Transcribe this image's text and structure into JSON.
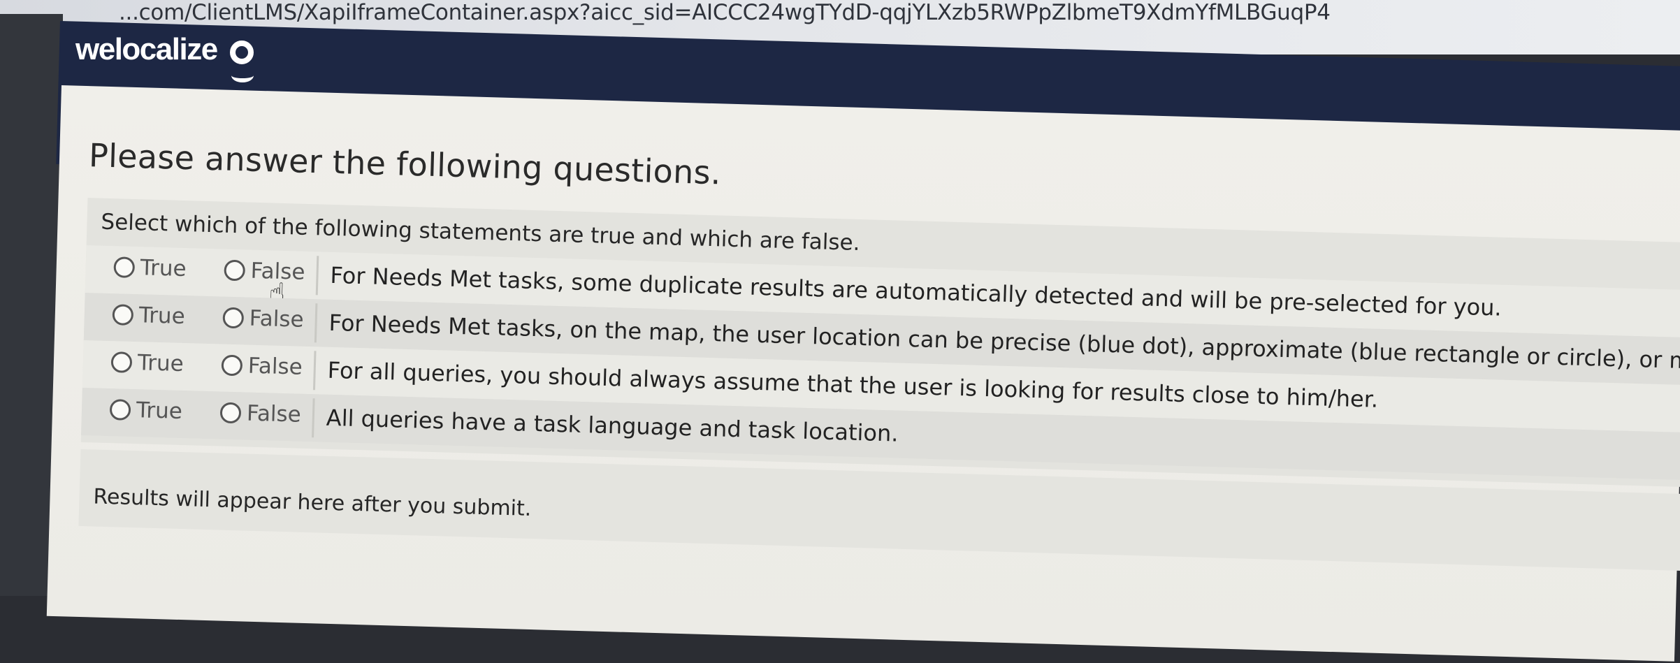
{
  "browser": {
    "url": "...com/ClientLMS/XapiIframeContainer.aspx?aicc_sid=AICCC24wgTYdD-qqjYLXzb5RWPpZlbmeT9XdmYfMLBGuqP4"
  },
  "header": {
    "logo_text": "welocalize"
  },
  "main": {
    "title": "Please answer the following questions.",
    "prompt": "Select which of the following statements are true and which are false.",
    "true_label": "True",
    "false_label": "False",
    "statements": [
      "For Needs Met tasks, some duplicate results are automatically detected and will be pre-selected for you.",
      "For Needs Met tasks, on the map, the user location can be precise (blue dot), approximate (blue rectangle or circle), or missi",
      "For all queries, you should always assume that the user is looking for results close to him/her.",
      "All queries have a task language and task location."
    ],
    "results_text": "Results will appear here after you submit."
  },
  "icons": {
    "cursor": "hand-pointer-icon",
    "logo": "welocalize-logo-mark"
  },
  "colors": {
    "header_bg": "#1d2744",
    "page_bg": "#f0efea"
  }
}
